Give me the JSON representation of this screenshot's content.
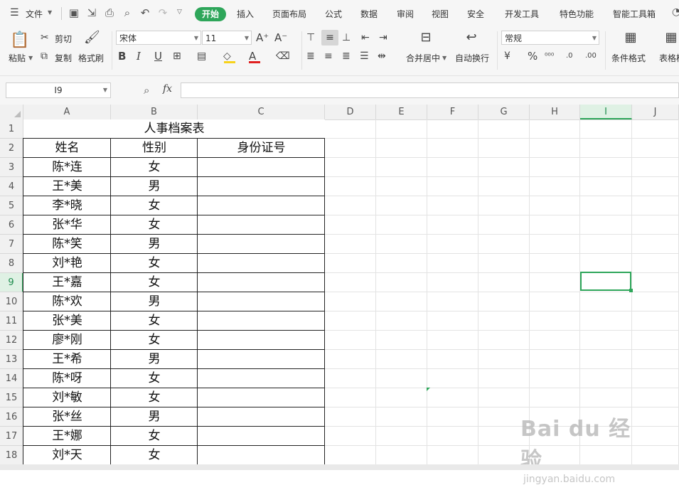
{
  "menu": {
    "file": "文件",
    "tabs": [
      "开始",
      "插入",
      "页面布局",
      "公式",
      "数据",
      "审阅",
      "视图",
      "安全",
      "开发工具",
      "特色功能",
      "智能工具箱"
    ]
  },
  "ribbon": {
    "paste": "粘贴",
    "cut": "剪切",
    "copy": "复制",
    "format_painter": "格式刷",
    "font_name": "宋体",
    "font_size": "11",
    "bold": "B",
    "italic": "I",
    "underline": "U",
    "merge_center": "合并居中",
    "wrap_text": "自动换行",
    "number_format": "常规",
    "percent": "%",
    "conditional_format": "条件格式",
    "table_style": "表格样"
  },
  "formula_bar": {
    "name_box": "I9",
    "fx": "fx",
    "content": ""
  },
  "columns": [
    "A",
    "B",
    "C",
    "D",
    "E",
    "F",
    "G",
    "H",
    "I",
    "J"
  ],
  "selected_column": "I",
  "selected_row": "9",
  "rows": [
    "1",
    "2",
    "3",
    "4",
    "5",
    "6",
    "7",
    "8",
    "9",
    "10",
    "11",
    "12",
    "13",
    "14",
    "15",
    "16",
    "17",
    "18"
  ],
  "sheet": {
    "title": "人事档案表",
    "headers": [
      "姓名",
      "性别",
      "身份证号"
    ],
    "records": [
      [
        "陈*连",
        "女"
      ],
      [
        "王*美",
        "男"
      ],
      [
        "李*晓",
        "女"
      ],
      [
        "张*华",
        "女"
      ],
      [
        "陈*笑",
        "男"
      ],
      [
        "刘*艳",
        "女"
      ],
      [
        "王*嘉",
        "女"
      ],
      [
        "陈*欢",
        "男"
      ],
      [
        "张*美",
        "女"
      ],
      [
        "廖*刚",
        "女"
      ],
      [
        "王*希",
        "男"
      ],
      [
        "陈*呀",
        "女"
      ],
      [
        "刘*敏",
        "女"
      ],
      [
        "张*丝",
        "男"
      ],
      [
        "王*娜",
        "女"
      ],
      [
        "刘*天",
        "女"
      ]
    ]
  },
  "watermark": {
    "brand": "Bai du 经验",
    "url": "jingyan.baidu.com"
  },
  "colors": {
    "accent": "#2ea65a",
    "font_red": "#e02020",
    "fill_yellow": "#f7d21b"
  }
}
